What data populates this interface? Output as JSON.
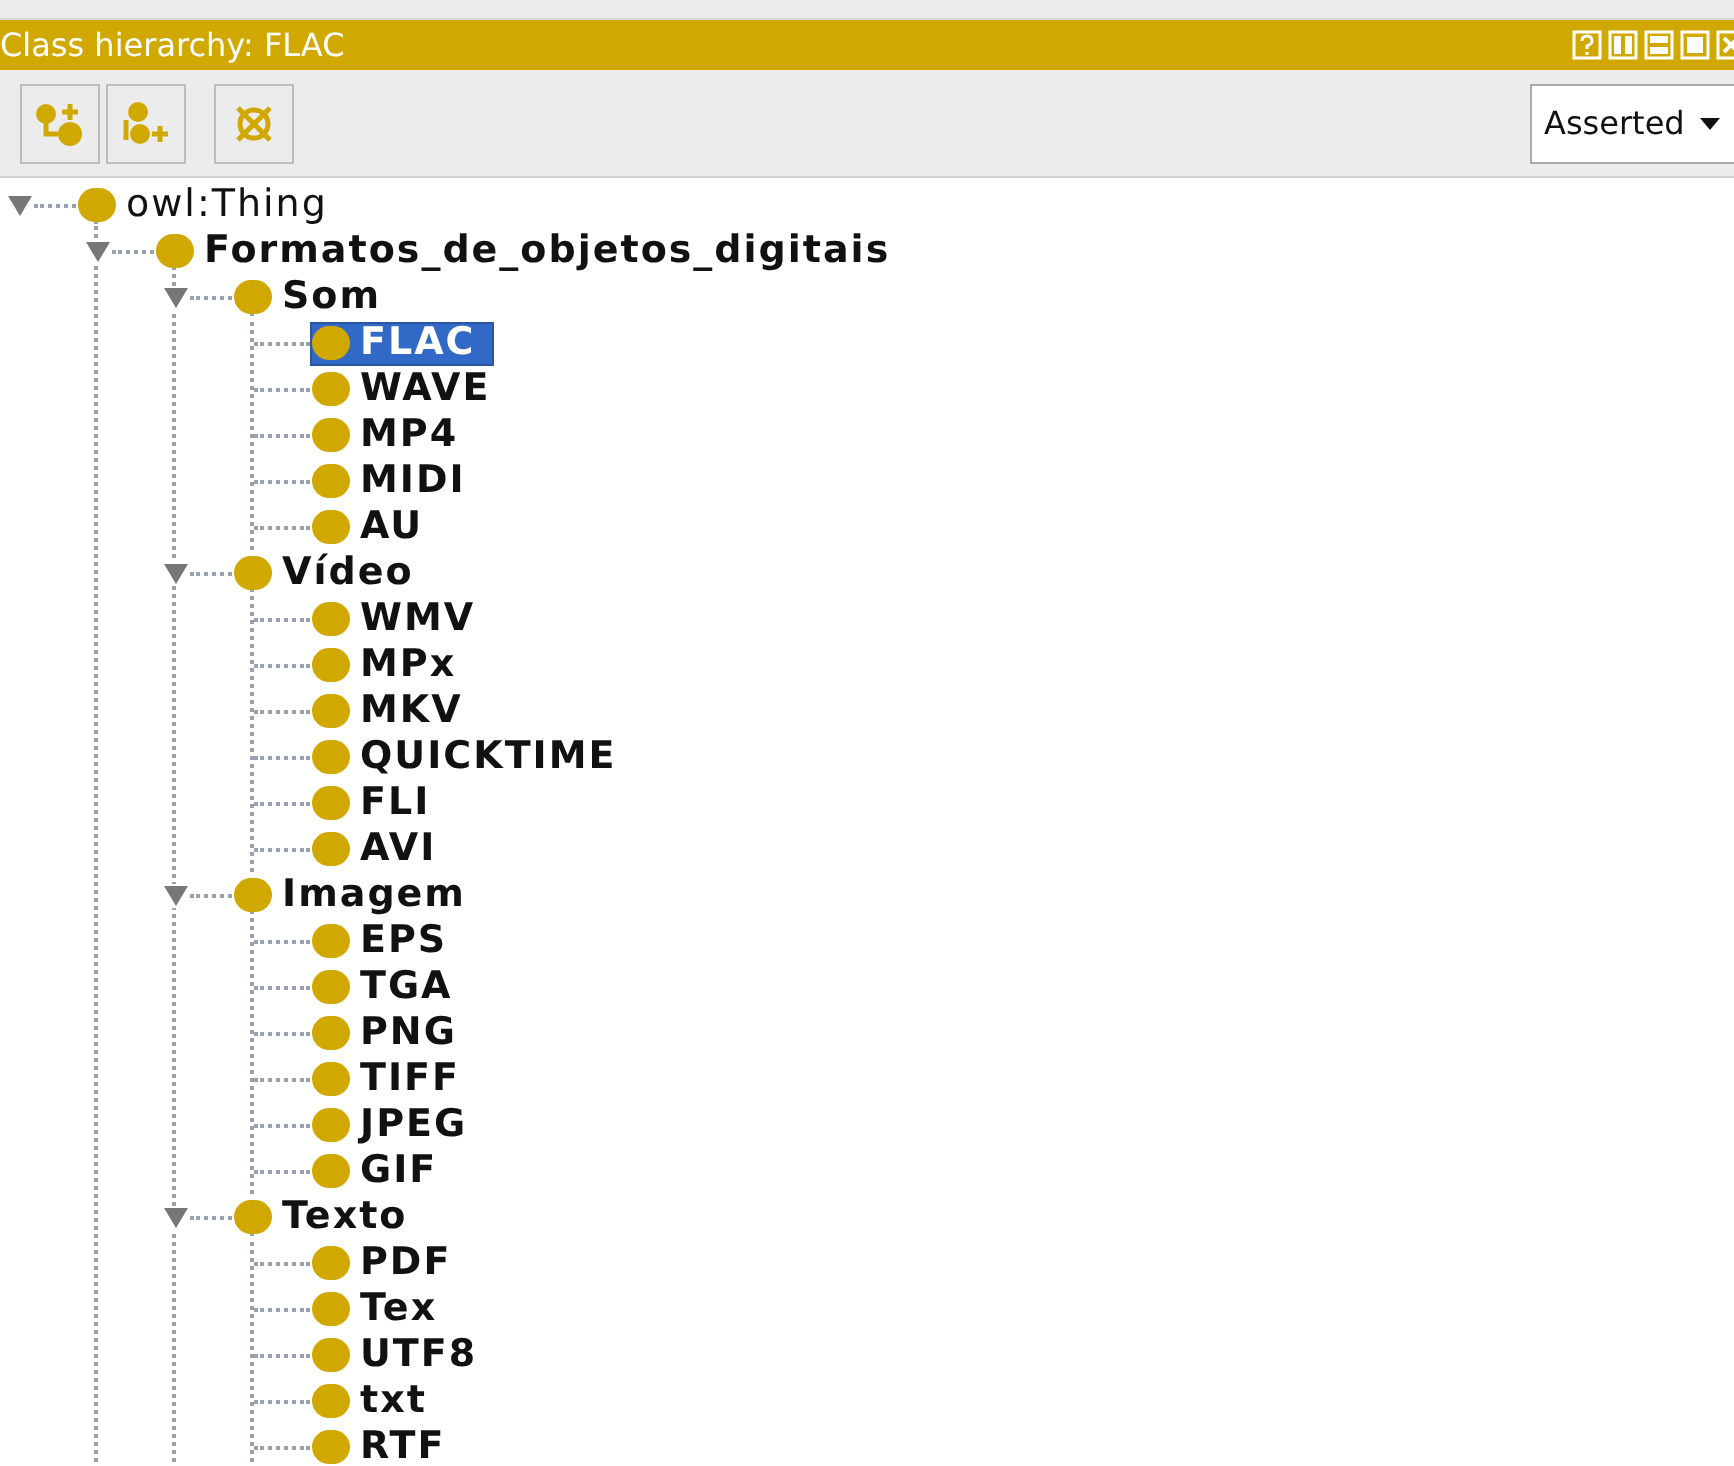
{
  "panel": {
    "title": "Class hierarchy: FLAC"
  },
  "view_selector": {
    "value": "Asserted"
  },
  "tree": [
    {
      "label": "owl:Thing",
      "expanded": true,
      "selected": false,
      "children": [
        {
          "label": "Formatos_de_objetos_digitais",
          "expanded": true,
          "selected": false,
          "children": [
            {
              "label": "Som",
              "expanded": true,
              "selected": false,
              "children": [
                {
                  "label": "FLAC",
                  "selected": true
                },
                {
                  "label": "WAVE",
                  "selected": false
                },
                {
                  "label": "MP4",
                  "selected": false
                },
                {
                  "label": "MIDI",
                  "selected": false
                },
                {
                  "label": "AU",
                  "selected": false
                }
              ]
            },
            {
              "label": "Vídeo",
              "expanded": true,
              "selected": false,
              "children": [
                {
                  "label": "WMV",
                  "selected": false
                },
                {
                  "label": "MPx",
                  "selected": false
                },
                {
                  "label": "MKV",
                  "selected": false
                },
                {
                  "label": "QUICKTIME",
                  "selected": false
                },
                {
                  "label": "FLI",
                  "selected": false
                },
                {
                  "label": "AVI",
                  "selected": false
                }
              ]
            },
            {
              "label": "Imagem",
              "expanded": true,
              "selected": false,
              "children": [
                {
                  "label": "EPS",
                  "selected": false
                },
                {
                  "label": "TGA",
                  "selected": false
                },
                {
                  "label": "PNG",
                  "selected": false
                },
                {
                  "label": "TIFF",
                  "selected": false
                },
                {
                  "label": "JPEG",
                  "selected": false
                },
                {
                  "label": "GIF",
                  "selected": false
                }
              ]
            },
            {
              "label": "Texto",
              "expanded": true,
              "selected": false,
              "children": [
                {
                  "label": "PDF",
                  "selected": false
                },
                {
                  "label": "Tex",
                  "selected": false
                },
                {
                  "label": "UTF8",
                  "selected": false
                },
                {
                  "label": "txt",
                  "selected": false
                },
                {
                  "label": "RTF",
                  "selected": false
                }
              ]
            }
          ]
        }
      ]
    }
  ]
}
